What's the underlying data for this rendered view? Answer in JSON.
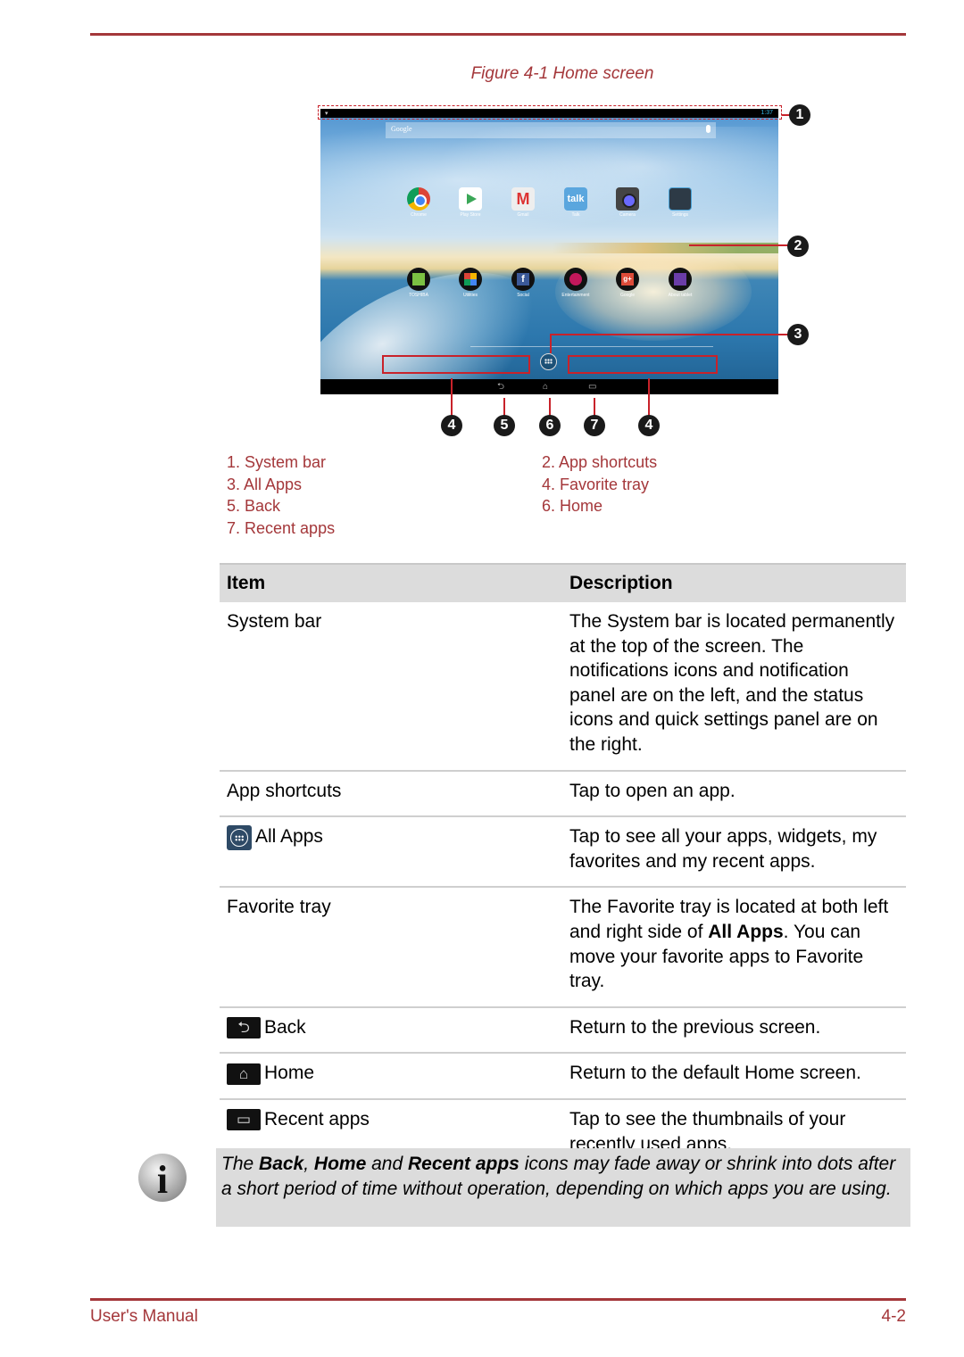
{
  "figure": {
    "caption": "Figure 4-1 Home screen",
    "tablet": {
      "search_label": "Google",
      "status_time": "1:37",
      "app_row1": [
        "Chrome",
        "Play Store",
        "Gmail",
        "Talk",
        "Camera",
        "Settings"
      ],
      "app_row2": [
        "TOSHIBA",
        "Utilities",
        "Social",
        "Entertainment",
        "Google",
        "About tablet"
      ],
      "nav_icons": [
        "back-icon",
        "home-icon",
        "recent-apps-icon"
      ]
    },
    "callouts": [
      "1",
      "2",
      "3",
      "4",
      "5",
      "6",
      "7",
      "4"
    ]
  },
  "legend": [
    "1. System bar",
    "2. App shortcuts",
    "3. All Apps",
    "4. Favorite tray",
    "5. Back",
    "6. Home",
    "7. Recent apps"
  ],
  "table": {
    "headers": [
      "Item",
      "Description"
    ],
    "rows": [
      {
        "item": "System bar",
        "icon": "",
        "desc": "The System bar is located permanently at the top of the screen. The notifications icons and notification panel are on the left, and the status icons and quick settings panel are on the right."
      },
      {
        "item": "App shortcuts",
        "icon": "",
        "desc": "Tap to open an app."
      },
      {
        "item": "All Apps",
        "icon": "all-apps-icon",
        "desc": "Tap to see all your apps, widgets, my favorites and my recent apps."
      },
      {
        "item": "Favorite tray",
        "icon": "",
        "desc_pre": "The Favorite tray is located at both left and right side of ",
        "desc_bold": "All Apps",
        "desc_post": ". You can move your favorite apps to Favorite tray."
      },
      {
        "item": "Back",
        "icon": "back-icon",
        "desc": "Return to the previous screen."
      },
      {
        "item": "Home",
        "icon": "home-icon",
        "desc": "Return to the default Home screen."
      },
      {
        "item": "Recent apps",
        "icon": "recent-apps-icon",
        "desc": "Tap to see the thumbnails of your recently used apps."
      }
    ]
  },
  "note": {
    "icon": "info-icon",
    "t1": "The ",
    "b1": "Back",
    "t2": ", ",
    "b2": "Home",
    "t3": " and ",
    "b3": "Recent apps",
    "t4": " icons may fade away or shrink into dots after a short period of time without operation, depending on which apps you are using."
  },
  "footer": {
    "left": "User's Manual",
    "right": "4-2"
  },
  "colors": {
    "accent": "#a4373a",
    "callout_red": "#c8222a",
    "header_bg": "#dcdcdc"
  }
}
